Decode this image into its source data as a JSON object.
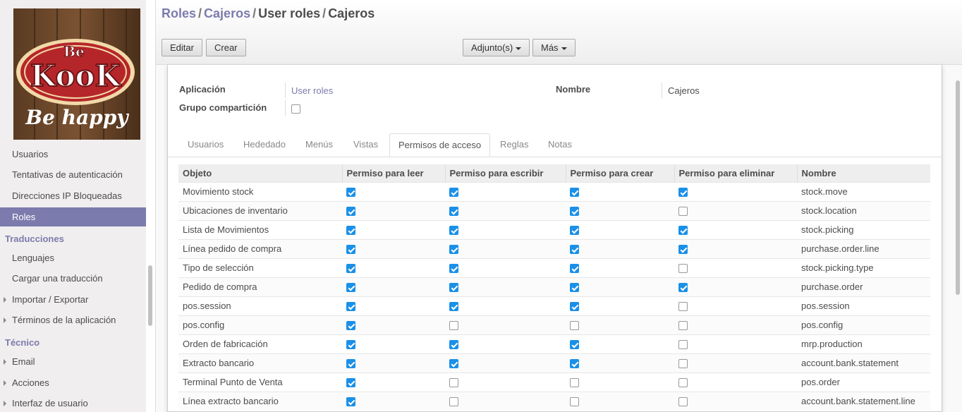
{
  "sidebar": {
    "logo": {
      "brand_top": "Be",
      "brand_main": "KooK",
      "tagline": "Be happy"
    },
    "items": [
      {
        "label": "Usuarios"
      },
      {
        "label": "Tentativas de autenticación"
      },
      {
        "label": "Direcciones IP Bloqueadas"
      },
      {
        "label": "Roles",
        "active": true
      }
    ],
    "sections": [
      {
        "title": "Traducciones",
        "items": [
          {
            "label": "Lenguajes"
          },
          {
            "label": "Cargar una traducción"
          },
          {
            "label": "Importar / Exportar",
            "expandable": true
          },
          {
            "label": "Términos de la aplicación",
            "expandable": true
          }
        ]
      },
      {
        "title": "Técnico",
        "items": [
          {
            "label": "Email",
            "expandable": true
          },
          {
            "label": "Acciones",
            "expandable": true
          },
          {
            "label": "Interfaz de usuario",
            "expandable": true
          }
        ]
      }
    ]
  },
  "breadcrumb": {
    "items": [
      "Roles",
      "Cajeros",
      "User roles",
      "Cajeros"
    ],
    "separator": "/"
  },
  "toolbar": {
    "edit_label": "Editar",
    "create_label": "Crear",
    "attachments_label": "Adjunto(s)",
    "more_label": "Más"
  },
  "form": {
    "application_label": "Aplicación",
    "application_value": "User roles",
    "share_group_label": "Grupo compartición",
    "share_group_checked": false,
    "name_label": "Nombre",
    "name_value": "Cajeros"
  },
  "tabs": [
    {
      "label": "Usuarios"
    },
    {
      "label": "Hededado"
    },
    {
      "label": "Menús"
    },
    {
      "label": "Vistas"
    },
    {
      "label": "Permisos de acceso",
      "active": true
    },
    {
      "label": "Reglas"
    },
    {
      "label": "Notas"
    }
  ],
  "table": {
    "columns": [
      "Objeto",
      "Permiso para leer",
      "Permiso para escribir",
      "Permiso para crear",
      "Permiso para eliminar",
      "Nombre"
    ],
    "rows": [
      {
        "object": "Movimiento stock",
        "read": true,
        "write": true,
        "create": true,
        "unlink": true,
        "name": "stock.move"
      },
      {
        "object": "Ubicaciones de inventario",
        "read": true,
        "write": true,
        "create": true,
        "unlink": false,
        "name": "stock.location"
      },
      {
        "object": "Lista de Movimientos",
        "read": true,
        "write": true,
        "create": true,
        "unlink": true,
        "name": "stock.picking"
      },
      {
        "object": "Línea pedido de compra",
        "read": true,
        "write": true,
        "create": true,
        "unlink": true,
        "name": "purchase.order.line"
      },
      {
        "object": "Tipo de selección",
        "read": true,
        "write": true,
        "create": true,
        "unlink": false,
        "name": "stock.picking.type"
      },
      {
        "object": "Pedido de compra",
        "read": true,
        "write": true,
        "create": true,
        "unlink": true,
        "name": "purchase.order"
      },
      {
        "object": "pos.session",
        "read": true,
        "write": true,
        "create": true,
        "unlink": false,
        "name": "pos.session"
      },
      {
        "object": "pos.config",
        "read": true,
        "write": false,
        "create": false,
        "unlink": false,
        "name": "pos.config"
      },
      {
        "object": "Orden de fabricación",
        "read": true,
        "write": true,
        "create": true,
        "unlink": false,
        "name": "mrp.production"
      },
      {
        "object": "Extracto bancario",
        "read": true,
        "write": true,
        "create": true,
        "unlink": false,
        "name": "account.bank.statement"
      },
      {
        "object": "Terminal Punto de Venta",
        "read": true,
        "write": false,
        "create": false,
        "unlink": false,
        "name": "pos.order"
      },
      {
        "object": "Línea extracto bancario",
        "read": true,
        "write": false,
        "create": false,
        "unlink": false,
        "name": "account.bank.statement.line"
      }
    ]
  },
  "colors": {
    "accent": "#7c7bad",
    "checkbox_on": "#1a90e8"
  }
}
